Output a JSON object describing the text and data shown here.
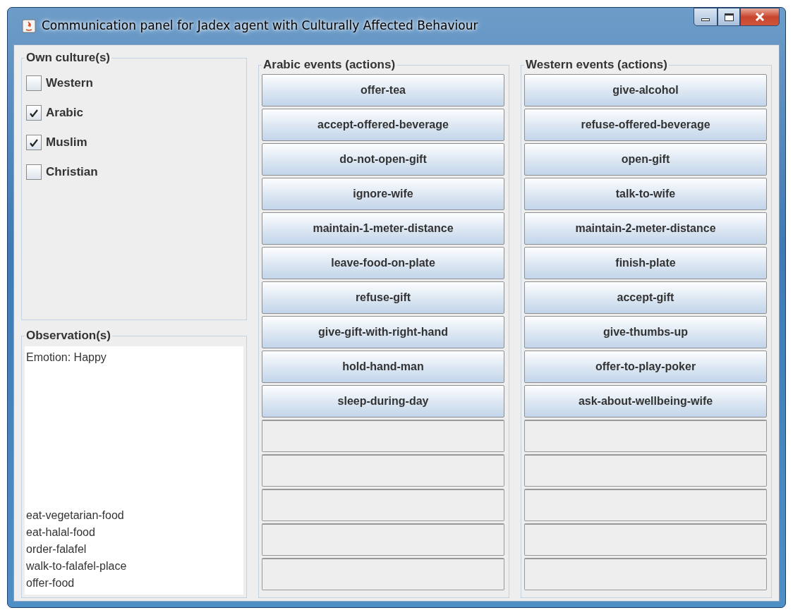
{
  "window": {
    "title": "Communication panel for Jadex agent with Culturally Affected Behaviour"
  },
  "own_cultures": {
    "title": "Own culture(s)",
    "items": [
      {
        "label": "Western",
        "checked": false
      },
      {
        "label": "Arabic",
        "checked": true
      },
      {
        "label": "Muslim",
        "checked": true
      },
      {
        "label": "Christian",
        "checked": false
      }
    ]
  },
  "observations": {
    "title": "Observation(s)",
    "emotion": "Emotion: Happy",
    "lines": [
      "eat-vegetarian-food",
      "eat-halal-food",
      "order-falafel",
      "walk-to-falafel-place",
      "offer-food"
    ]
  },
  "event_columns": [
    {
      "title": "Arabic events (actions)",
      "actions": [
        "offer-tea",
        "accept-offered-beverage",
        "do-not-open-gift",
        "ignore-wife",
        "maintain-1-meter-distance",
        "leave-food-on-plate",
        "refuse-gift",
        "give-gift-with-right-hand",
        "hold-hand-man",
        "sleep-during-day"
      ]
    },
    {
      "title": "Western events (actions)",
      "actions": [
        "give-alcohol",
        "refuse-offered-beverage",
        "open-gift",
        "talk-to-wife",
        "maintain-2-meter-distance",
        "finish-plate",
        "accept-gift",
        "give-thumbs-up",
        "offer-to-play-poker",
        "ask-about-wellbeing-wife"
      ]
    }
  ]
}
